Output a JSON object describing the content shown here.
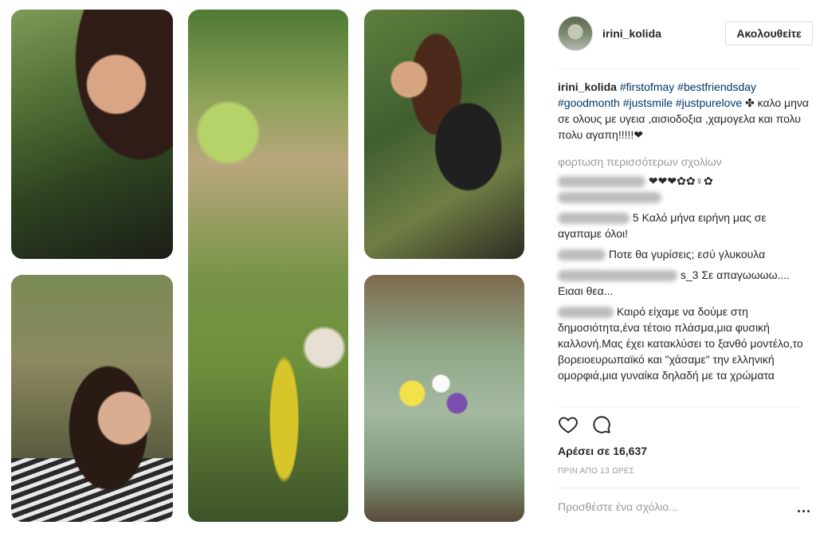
{
  "post": {
    "username": "irini_kolida",
    "follow_label": "Ακολουθείτε",
    "caption": {
      "user": "irini_kolida",
      "tags": [
        "#firstofmay",
        "#bestfriendsday",
        "#goodmonth",
        "#justsmile",
        "#justpurelove"
      ],
      "tail_symbol": "✤",
      "text": "καλο μηνα σε ολους με υγεια ,αισιοδοξια ,χαμογελα και πολυ πολυ αγαπη!!!!!❤"
    },
    "load_more": "φορτωση περισσότερων σχολίων",
    "comments": [
      {
        "text": "❤❤❤✿✿♀✿"
      },
      {
        "text": "5 Καλό μήνα ειρήνη μας σε αγαπαμε όλοι!"
      },
      {
        "text": "Ποτε θα γυρίσεις; εσύ γλυκουλα"
      },
      {
        "text": "s_3 Σε απαγωωωω.... Ειααι θεα..."
      },
      {
        "text": "Καιρό είχαμε να δούμε στη δημοσιότητα,ένα τέτοιο πλάσμα,μια φυσική καλλονή.Μας έχει κατακλύσει το ξανθό μοντέλο,το βορειοευρωπαϊκό και \"χάσαμε\" την ελληνική ομορφιά,μια γυναίκα δηλαδή με τα χρώματα"
      }
    ],
    "likes_label": "Αρέσει σε 16,637",
    "time_label": "ΠΡΙΝ ΑΠΟ 13 ΩΡΕΣ",
    "add_comment_placeholder": "Προσθέστε ένα σχόλιο...",
    "more_options": "..."
  },
  "icons": {
    "like": "heart-icon",
    "comment": "speech-bubble-icon"
  }
}
